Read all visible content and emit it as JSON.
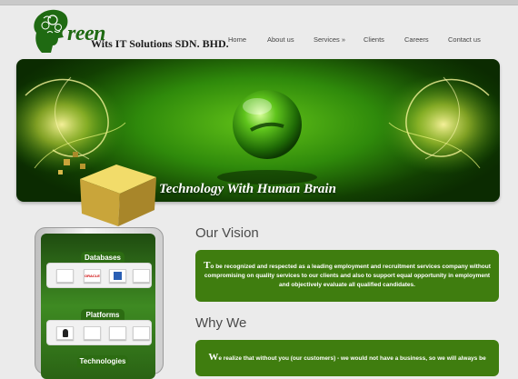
{
  "logo": {
    "mark": "reen",
    "company": "Wits IT Solutions SDN. BHD."
  },
  "nav": {
    "items": [
      {
        "label": "Home"
      },
      {
        "label": "About us"
      },
      {
        "label": "Services »"
      },
      {
        "label": "Clients"
      },
      {
        "label": "Careers"
      },
      {
        "label": "Contact us"
      }
    ]
  },
  "banner": {
    "tagline": "Technology With Human Brain"
  },
  "sidebar": {
    "sections": [
      {
        "label": "Databases"
      },
      {
        "label": "Platforms"
      },
      {
        "label": "Technologies"
      }
    ]
  },
  "vision": {
    "heading": "Our Vision",
    "dropcap": "T",
    "text": "o be recognized and respected as a leading employment and recruitment services company without compromising on quality services to our clients and also to support equal opportunity in employment and objectively evaluate all qualified candidates."
  },
  "why": {
    "heading": "Why We",
    "dropcap": "W",
    "text": "e realize that without you (our customers) - we would not have a business, so we will always be"
  },
  "colors": {
    "accent_green": "#3f7d0f",
    "background": "#ebebeb"
  }
}
